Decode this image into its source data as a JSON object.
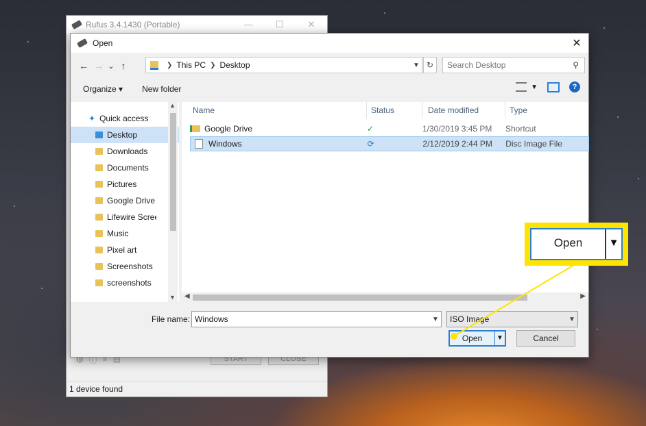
{
  "rufus": {
    "title": "Rufus 3.4.1430 (Portable)",
    "status": "1 device found",
    "start_label": "START",
    "close_label": "CLOSE"
  },
  "dialog": {
    "title": "Open",
    "close_glyph": "✕"
  },
  "nav": {
    "back": "←",
    "forward": "→",
    "recent": "⌄",
    "up": "↑",
    "breadcrumb": [
      "This PC",
      "Desktop"
    ],
    "refresh": "↻",
    "search_placeholder": "Search Desktop"
  },
  "toolbar": {
    "organize": "Organize ▾",
    "new_folder": "New folder"
  },
  "navpane": {
    "quick_access": "Quick access",
    "items": [
      {
        "label": "Desktop",
        "pinned": true,
        "selected": true
      },
      {
        "label": "Downloads",
        "pinned": true
      },
      {
        "label": "Documents",
        "pinned": true
      },
      {
        "label": "Pictures",
        "pinned": true
      },
      {
        "label": "Google Drive",
        "pinned": true
      },
      {
        "label": "Lifewire Scree",
        "pinned": true
      },
      {
        "label": "Music",
        "pinned": false
      },
      {
        "label": "Pixel art",
        "pinned": false
      },
      {
        "label": "Screenshots",
        "pinned": false
      },
      {
        "label": "screenshots",
        "pinned": false
      }
    ]
  },
  "files": {
    "columns": [
      "Name",
      "Status",
      "Date modified",
      "Type"
    ],
    "rows": [
      {
        "name": "Google Drive",
        "status_icon": "check-circle-icon",
        "status": "✓",
        "date": "1/30/2019 3:45 PM",
        "type": "Shortcut",
        "selected": false
      },
      {
        "name": "Windows",
        "status_icon": "sync-icon",
        "status": "⟳",
        "date": "2/12/2019 2:44 PM",
        "type": "Disc Image File",
        "selected": true
      }
    ]
  },
  "bottom": {
    "file_name_label": "File name:",
    "file_name_value": "Windows",
    "file_type": "ISO Image",
    "open_label": "Open",
    "cancel_label": "Cancel"
  },
  "callout": {
    "label": "Open",
    "color": "#ffe400"
  },
  "colors": {
    "accent": "#2b7fd0",
    "selection": "#cde2f6"
  }
}
